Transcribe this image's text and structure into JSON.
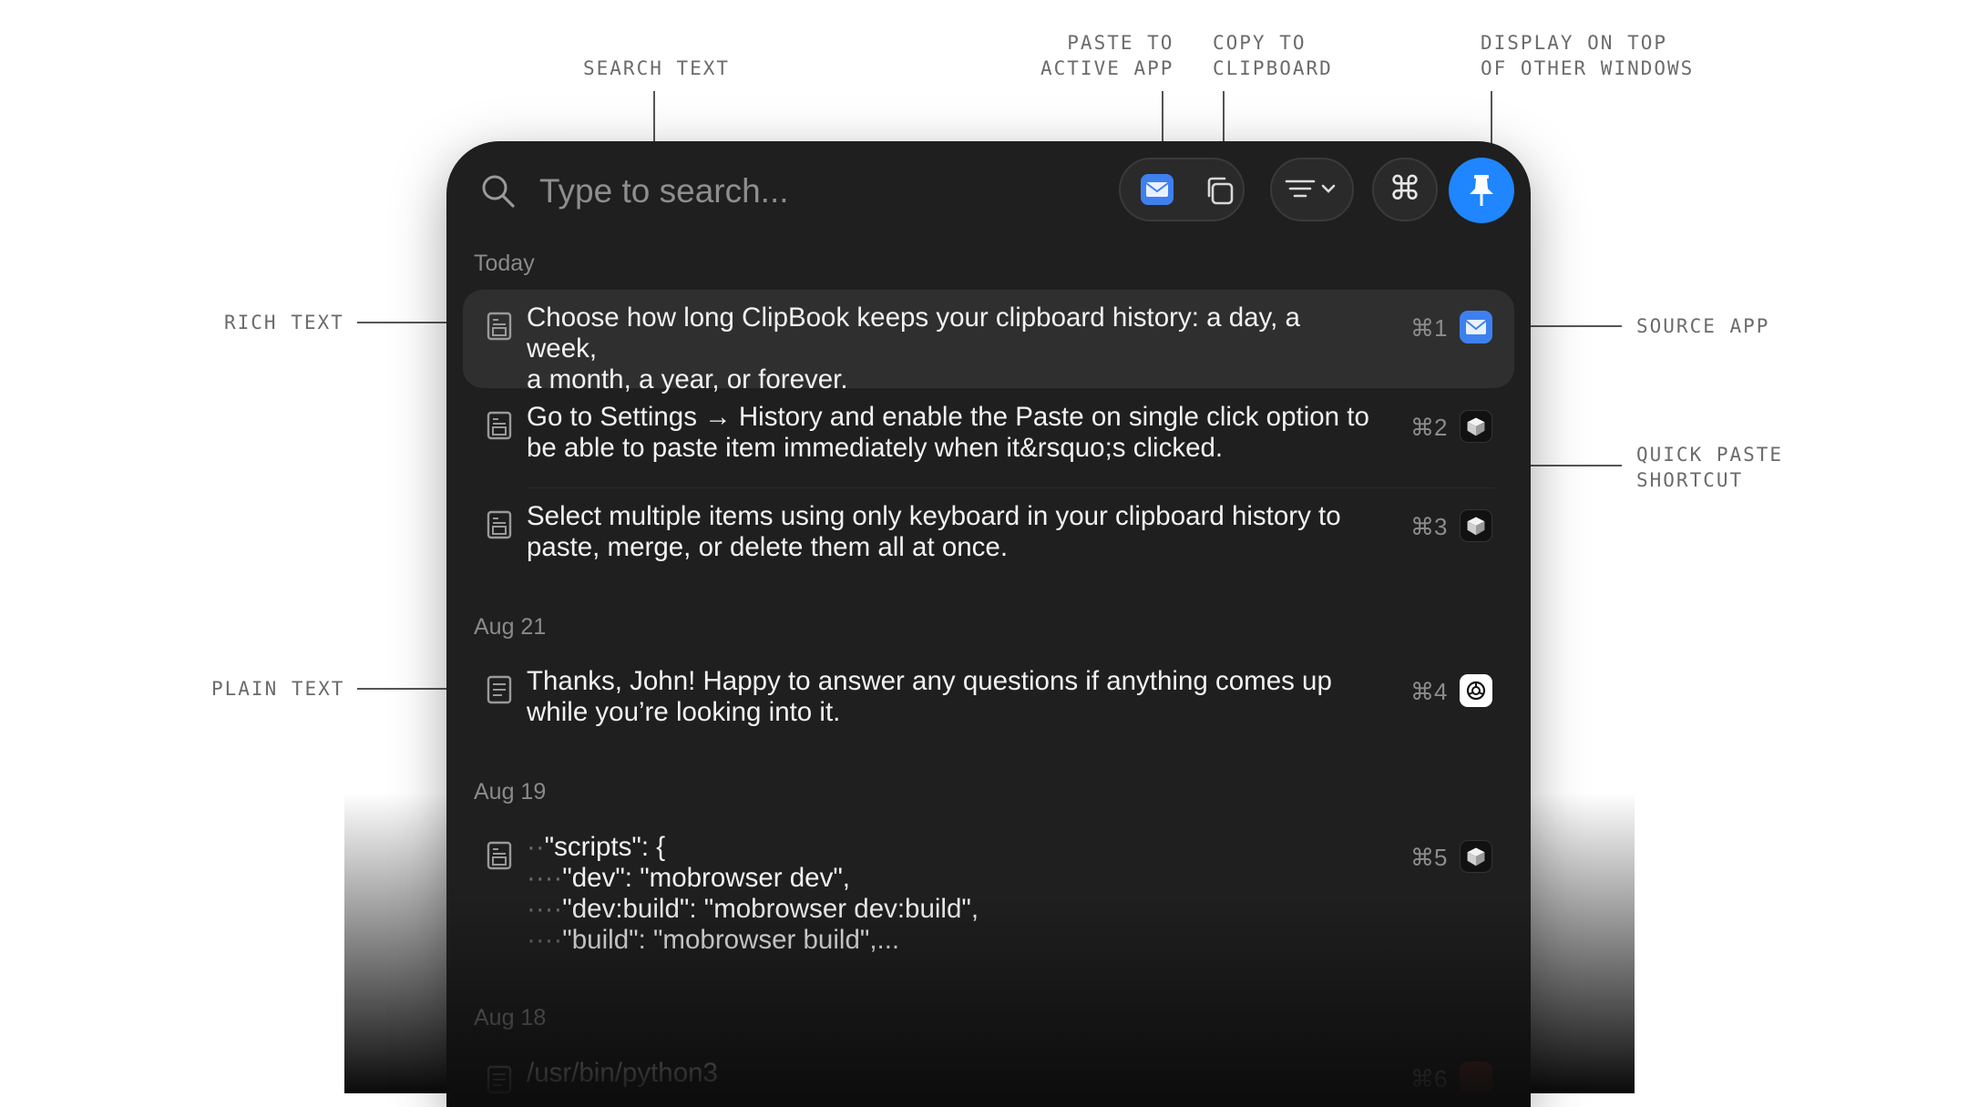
{
  "callouts": {
    "search_text": "SEARCH TEXT",
    "paste_to_active_app": "PASTE TO\nACTIVE APP",
    "copy_to_clipboard": "COPY TO\nCLIPBOARD",
    "display_on_top": "DISPLAY ON TOP\nOF OTHER WINDOWS",
    "rich_text": "RICH TEXT",
    "source_app": "SOURCE APP",
    "quick_paste_shortcut": "QUICK PASTE\nSHORTCUT",
    "plain_text": "PLAIN TEXT"
  },
  "search": {
    "placeholder": "Type to search..."
  },
  "toolbar": {
    "icons": [
      "mail-app-icon",
      "copy-icon",
      "filter-icon",
      "command-icon",
      "pin-icon"
    ],
    "accent": "#1f86ff"
  },
  "sections": [
    {
      "label": "Today"
    },
    {
      "label": "Aug 21"
    },
    {
      "label": "Aug 19"
    },
    {
      "label": "Aug 18"
    }
  ],
  "items": [
    {
      "type": "rich-text",
      "line1": "Choose how long ClipBook keeps your clipboard history: a day, a week,",
      "line2": "a month, a year, or forever.",
      "shortcut": "⌘1",
      "app": "mail"
    },
    {
      "type": "rich-text",
      "line1": "Go to Settings → History and enable the Paste on single click option to",
      "line2": "be able to paste item immediately when it&rsquo;s clicked.",
      "shortcut": "⌘2",
      "app": "cube"
    },
    {
      "type": "rich-text",
      "line1": "Select multiple items using only keyboard in your clipboard history to",
      "line2": "paste, merge, or delete them all at once.",
      "shortcut": "⌘3",
      "app": "cube"
    },
    {
      "type": "plain-text",
      "line1": "Thanks, John! Happy to answer any questions if anything comes up",
      "line2": "while you’re looking into it.",
      "shortcut": "⌘4",
      "app": "chatgpt"
    },
    {
      "type": "rich-text",
      "code": [
        {
          "dots": "··",
          "text": "\"scripts\": {"
        },
        {
          "dots": "····",
          "text": "\"dev\": \"mobrowser dev\","
        },
        {
          "dots": "····",
          "text": "\"dev:build\": \"mobrowser dev:build\","
        },
        {
          "dots": "····",
          "text": "\"build\": \"mobrowser build\",..."
        }
      ],
      "shortcut": "⌘5",
      "app": "cube"
    },
    {
      "type": "plain-text",
      "line1": "/usr/bin/python3",
      "shortcut": "⌘6",
      "app": "red"
    }
  ]
}
